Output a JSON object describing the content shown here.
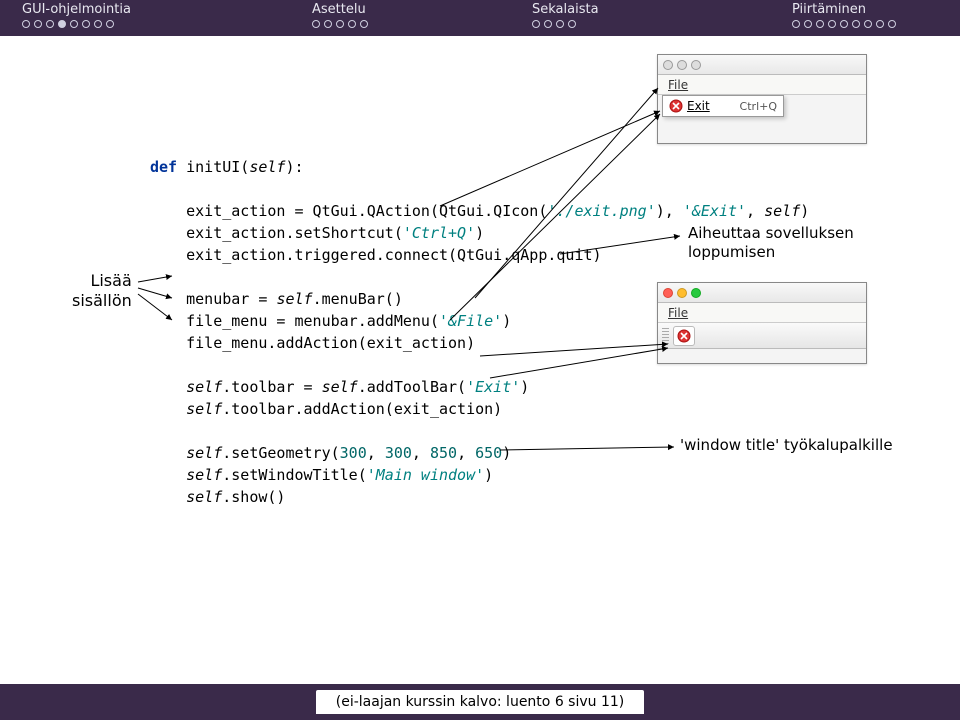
{
  "nav": {
    "items": [
      {
        "label": "GUI-ohjelmointia",
        "dots": [
          0,
          0,
          0,
          1,
          0,
          0,
          0,
          0
        ]
      },
      {
        "label": "Asettelu",
        "dots": [
          0,
          0,
          0,
          0,
          0
        ]
      },
      {
        "label": "Sekalaista",
        "dots": [
          0,
          0,
          0,
          0
        ]
      },
      {
        "label": "Piirtäminen",
        "dots": [
          0,
          0,
          0,
          0,
          0,
          0,
          0,
          0,
          0
        ]
      }
    ]
  },
  "code": {
    "l1_def": "def",
    "l1_name": " initUI(",
    "l1_self": "self",
    "l1_end": "):",
    "l3a": "    exit_action = QtGui.QAction(QtGui.QIcon(",
    "l3s1": "'./exit.png'",
    "l3b": "), ",
    "l3s2": "'&Exit'",
    "l3c": ", ",
    "l3self": "self",
    "l3d": ")",
    "l4a": "    exit_action.setShortcut(",
    "l4s": "'Ctrl+Q'",
    "l4b": ")",
    "l5": "    exit_action.triggered.connect(QtGui.qApp.quit)",
    "l7a": "    menubar = ",
    "l7self": "self",
    "l7b": ".menuBar()",
    "l8a": "    file_menu = menubar.addMenu(",
    "l8s": "'&File'",
    "l8b": ")",
    "l9": "    file_menu.addAction(exit_action)",
    "l11a": "    ",
    "l11self": "self",
    "l11b": ".toolbar = ",
    "l11self2": "self",
    "l11c": ".addToolBar(",
    "l11s": "'Exit'",
    "l11d": ")",
    "l12a": "    ",
    "l12self": "self",
    "l12b": ".toolbar.addAction(exit_action)",
    "l14a": "    ",
    "l14self": "self",
    "l14b": ".setGeometry(",
    "l14n1": "300",
    "l14c": ", ",
    "l14n2": "300",
    "l14d": ", ",
    "l14n3": "850",
    "l14e": ", ",
    "l14n4": "650",
    "l14f": ")",
    "l15a": "    ",
    "l15self": "self",
    "l15b": ".setWindowTitle(",
    "l15s": "'Main window'",
    "l15c": ")",
    "l16a": "    ",
    "l16self": "self",
    "l16b": ".show()"
  },
  "annotations": {
    "left_l1": "Lisää",
    "left_l2": "sisällön",
    "right1_l1": "Aiheuttaa sovelluksen",
    "right1_l2": "loppumisen",
    "right2": "'window title' työkalupalkille"
  },
  "window1": {
    "menu_file": "File",
    "menuitem_exit": "Exit",
    "menuitem_shortcut": "Ctrl+Q"
  },
  "window2": {
    "menu_file": "File"
  },
  "footer": "(ei-laajan kurssin kalvo: luento 6 sivu 11)"
}
